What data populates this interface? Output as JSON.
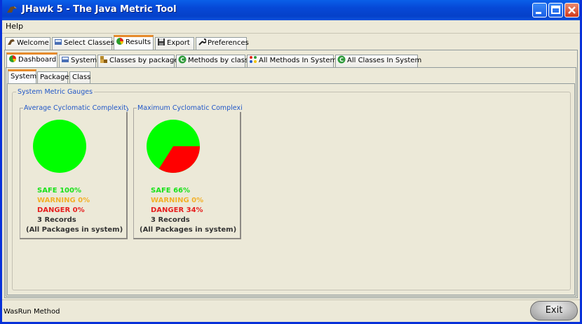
{
  "window": {
    "title": "JHawk 5 - The Java Metric Tool",
    "minimize_icon": "minimize-icon",
    "maximize_icon": "maximize-icon",
    "close_icon": "close-icon"
  },
  "menu": {
    "items": [
      {
        "label": "Help"
      }
    ]
  },
  "main_tabs": [
    {
      "label": "Welcome",
      "icon": "welcome-icon"
    },
    {
      "label": "Select Classes",
      "icon": "select-classes-icon"
    },
    {
      "label": "Results",
      "icon": "pie-chart-icon",
      "active": true
    },
    {
      "label": "Export",
      "icon": "floppy-disk-icon"
    },
    {
      "label": "Preferences",
      "icon": "wrench-icon"
    }
  ],
  "result_tabs": [
    {
      "label": "Dashboard",
      "icon": "pie-chart-icon",
      "active": true
    },
    {
      "label": "System",
      "icon": "system-icon"
    },
    {
      "label": "Classes by package",
      "icon": "package-icon"
    },
    {
      "label": "Methods by class",
      "icon": "class-c-icon"
    },
    {
      "label": "All Methods In System",
      "icon": "methods-grid-icon"
    },
    {
      "label": "All Classes In System",
      "icon": "class-c-icon"
    }
  ],
  "level_tabs": [
    {
      "label": "System",
      "active": true
    },
    {
      "label": "Package"
    },
    {
      "label": "Class"
    }
  ],
  "group_title": "System Metric Gauges",
  "colors": {
    "safe": "#00ff00",
    "warning": "#ffc800",
    "danger": "#ff0000",
    "stats_safe": "#19e219",
    "stats_warning": "#f2b12a",
    "stats_danger": "#e61e1e"
  },
  "gauges": [
    {
      "title": "Average Cyclomatic Complexity fc",
      "safe_pct": 1.0,
      "danger_pct": 0.0,
      "safe_text": "SAFE 100%",
      "warning_text": "WARNING 0%",
      "danger_text": "DANGER 0%",
      "records_text": "3 Records",
      "scope_text": "(All Packages in system)"
    },
    {
      "title": "Maximum Cyclomatic Complexity",
      "safe_pct": 0.66,
      "danger_pct": 0.34,
      "safe_text": "SAFE 66%",
      "warning_text": "WARNING 0%",
      "danger_text": "DANGER 34%",
      "records_text": "3 Records",
      "scope_text": "(All Packages in system)"
    }
  ],
  "status": {
    "text": "WasRun Method"
  },
  "exit_label": "Exit"
}
